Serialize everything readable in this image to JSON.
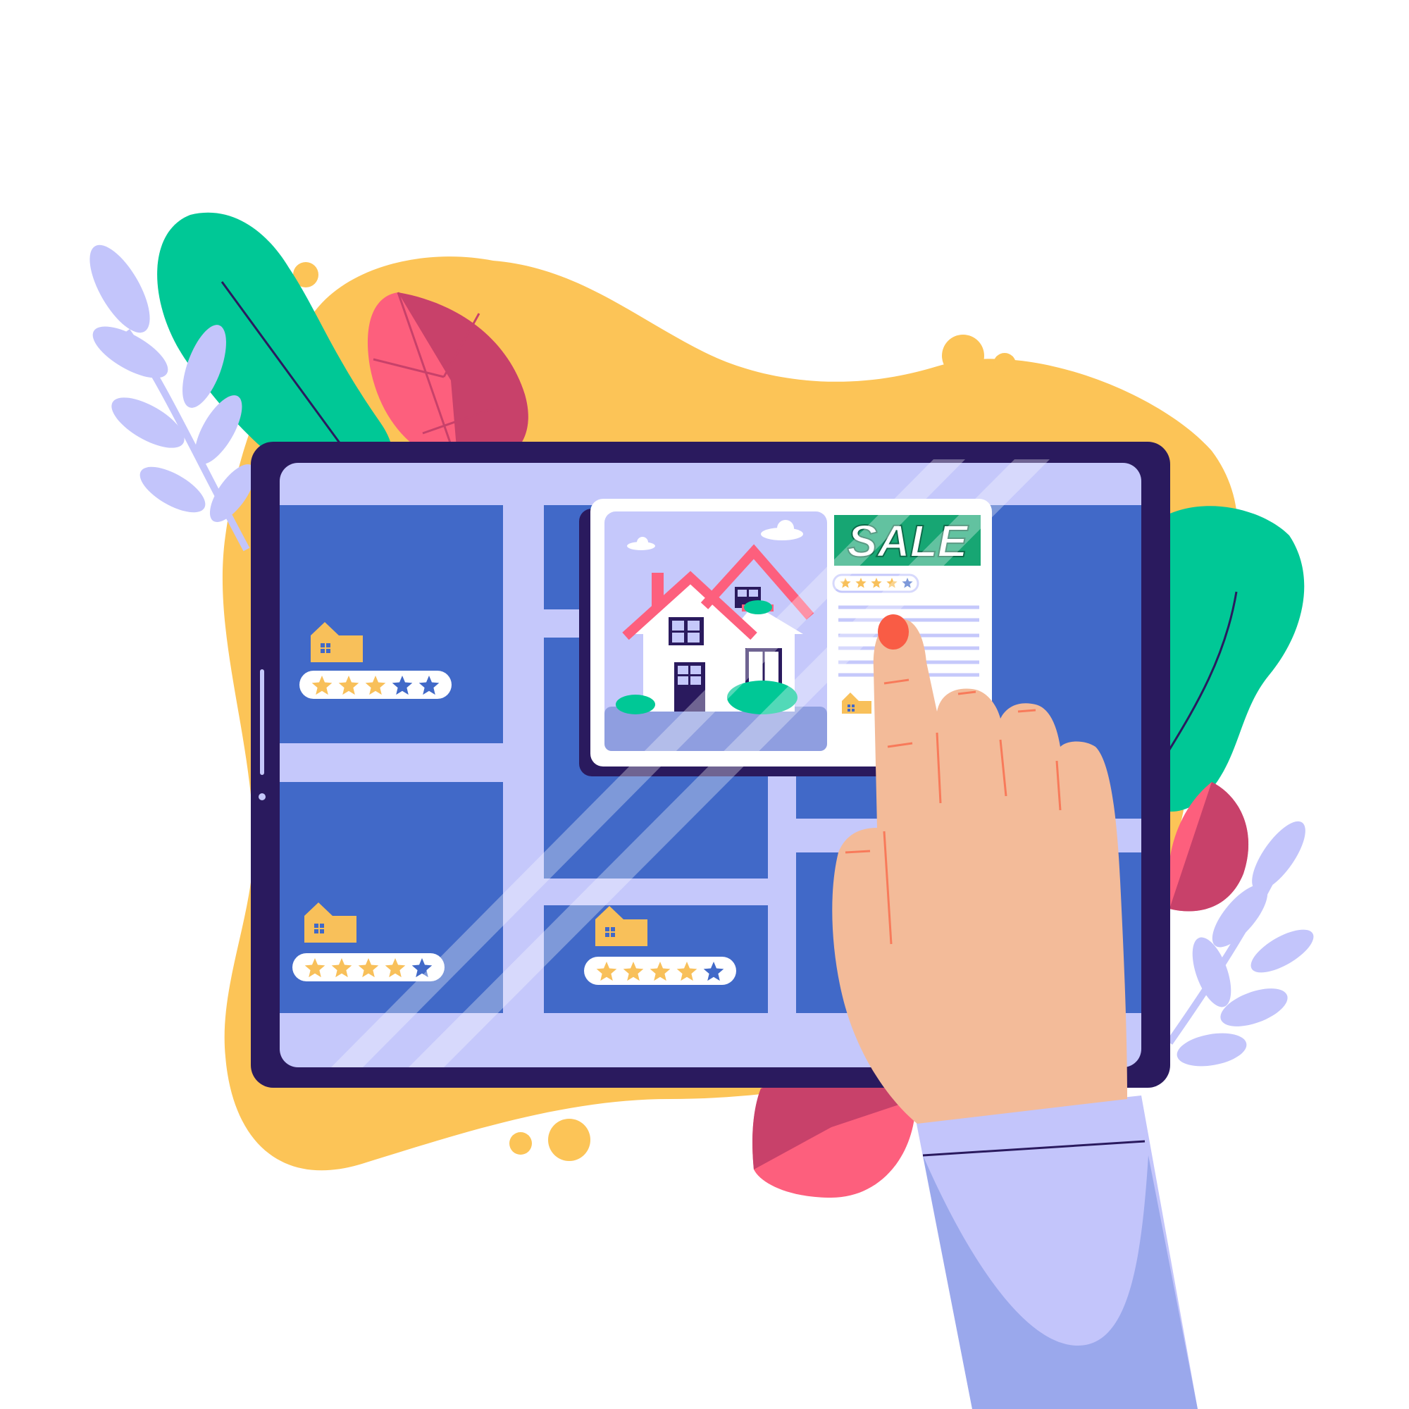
{
  "colors": {
    "background": "#ffffff",
    "blob_yellow": "#fcc457",
    "leaf_green": "#00c896",
    "leaf_red": "#fd5f7d",
    "leaf_red_dark": "#c8416a",
    "sprig_lavender": "#c3c5fb",
    "tablet_frame": "#2a1a5e",
    "screen_bg": "#c5c8fb",
    "map_block": "#4169c8",
    "house_icon": "#f8c05a",
    "star_filled": "#f8c05a",
    "star_empty": "#4169c8",
    "sale_banner": "#17a673",
    "hand_skin": "#f3bb99",
    "nail": "#f95c45",
    "sleeve": "#c3c5fb"
  },
  "listings": [
    {
      "name": "listing-top-left",
      "rating": 3,
      "max_rating": 5
    },
    {
      "name": "listing-bottom-left",
      "rating": 4,
      "max_rating": 5
    },
    {
      "name": "listing-bottom-middle",
      "rating": 4,
      "max_rating": 5
    }
  ],
  "featured": {
    "badge": "SALE",
    "rating": 4,
    "max_rating": 5
  }
}
